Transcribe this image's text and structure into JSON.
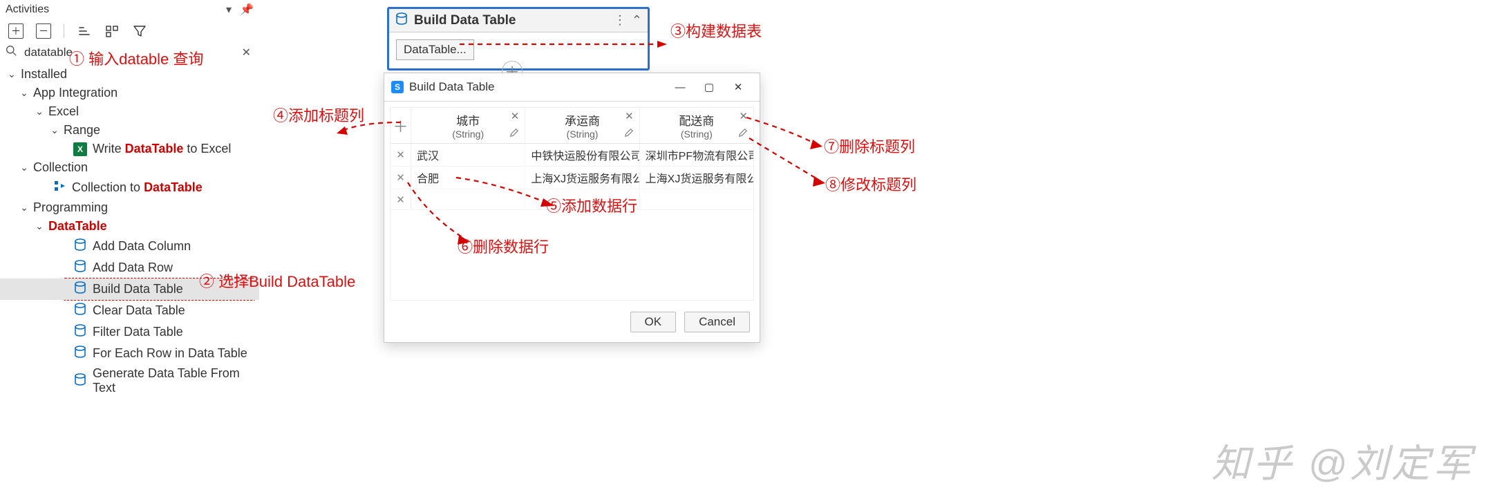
{
  "panel": {
    "title": "Activities",
    "search_value": "datatable",
    "tree": {
      "installed": "Installed",
      "app_integration": "App Integration",
      "excel": "Excel",
      "range": "Range",
      "write_dt_prefix": "Write ",
      "write_dt_bold": "DataTable",
      "write_dt_suffix": " to Excel",
      "collection": "Collection",
      "collection_to": "Collection to ",
      "collection_to_bold": "DataTable",
      "programming": "Programming",
      "datatable_grp": "DataTable",
      "items": [
        "Add Data Column",
        "Add Data Row",
        "Build Data Table",
        "Clear Data Table",
        "Filter Data Table",
        "For Each Row in Data Table",
        "Generate Data Table From Text"
      ]
    }
  },
  "card": {
    "title": "Build Data Table",
    "prop_button": "DataTable..."
  },
  "dialog": {
    "title": "Build Data Table",
    "columns": [
      {
        "name": "城市",
        "type": "(String)"
      },
      {
        "name": "承运商",
        "type": "(String)"
      },
      {
        "name": "配送商",
        "type": "(String)"
      }
    ],
    "rows": [
      [
        "武汉",
        "中铁快运股份有限公司",
        "深圳市PF物流有限公司"
      ],
      [
        "合肥",
        "上海XJ货运服务有限公司",
        "上海XJ货运服务有限公司"
      ]
    ],
    "ok": "OK",
    "cancel": "Cancel"
  },
  "annotations": {
    "a1": "① 输入datable 查询",
    "a2": "② 选择Build DataTable",
    "a3": "③构建数据表",
    "a4": "④添加标题列",
    "a5": "⑤添加数据行",
    "a6": "⑥删除数据行",
    "a7": "⑦删除标题列",
    "a8": "⑧修改标题列"
  },
  "watermark": "知乎 @刘定军"
}
